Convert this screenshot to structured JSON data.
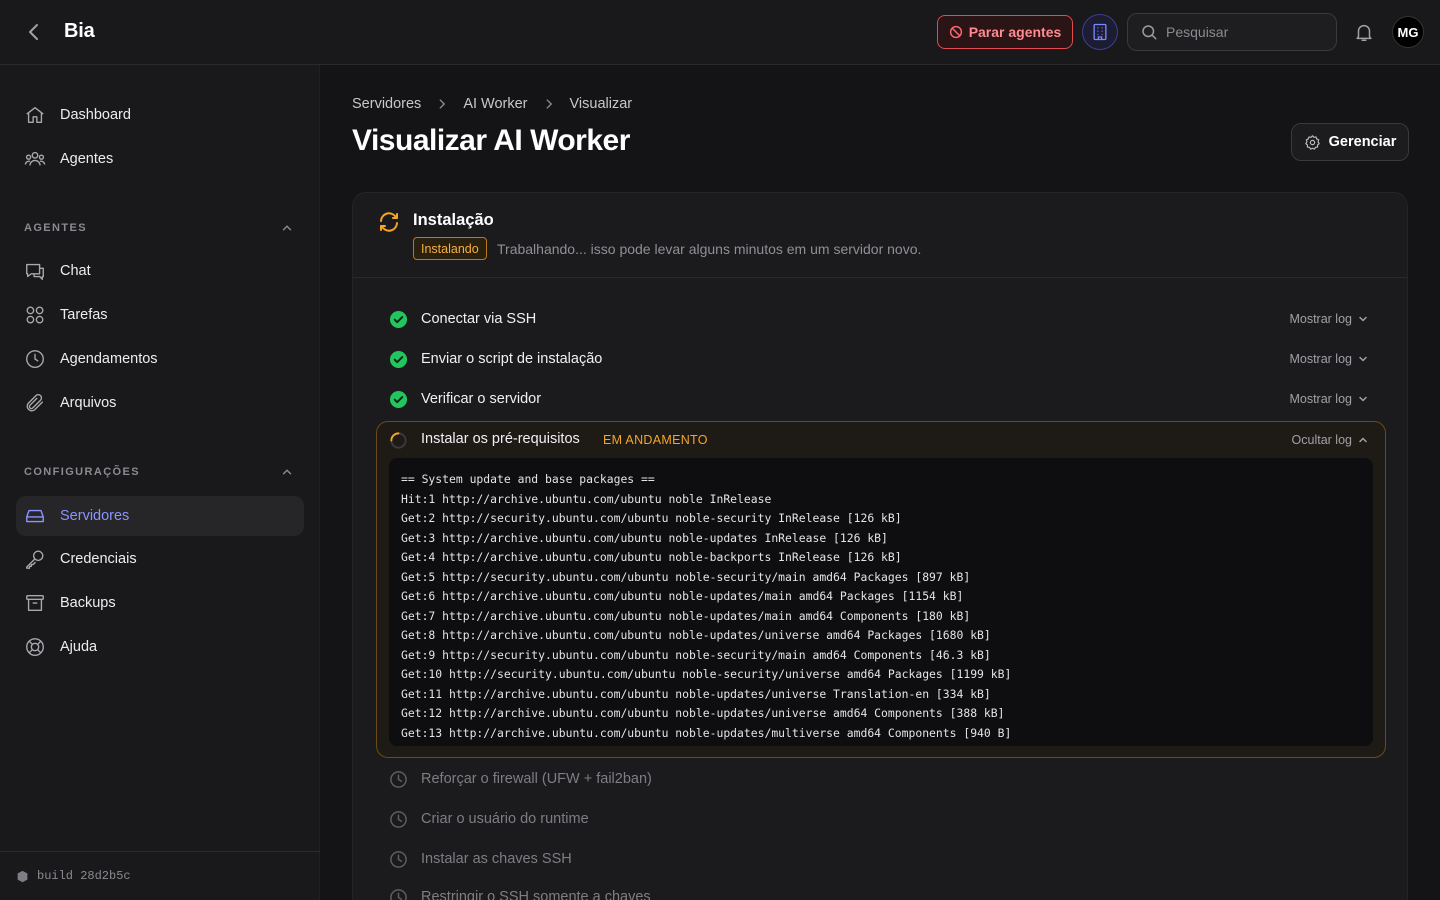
{
  "header": {
    "app_title": "Bia",
    "stop_agents_label": "Parar agentes",
    "search_placeholder": "Pesquisar",
    "avatar_initials": "MG"
  },
  "sidebar": {
    "top_items": [
      {
        "label": "Dashboard",
        "icon": "home-icon"
      },
      {
        "label": "Agentes",
        "icon": "users-icon"
      }
    ],
    "sections": [
      {
        "title": "AGENTES",
        "items": [
          {
            "label": "Chat",
            "icon": "chat-icon"
          },
          {
            "label": "Tarefas",
            "icon": "grid-icon"
          },
          {
            "label": "Agendamentos",
            "icon": "clock-icon"
          },
          {
            "label": "Arquivos",
            "icon": "paperclip-icon"
          }
        ]
      },
      {
        "title": "CONFIGURAÇÕES",
        "items": [
          {
            "label": "Servidores",
            "icon": "server-icon",
            "active": true
          },
          {
            "label": "Credenciais",
            "icon": "key-icon"
          },
          {
            "label": "Backups",
            "icon": "archive-icon"
          },
          {
            "label": "Ajuda",
            "icon": "lifebuoy-icon"
          }
        ]
      }
    ],
    "build_label": "build 28d2b5c"
  },
  "breadcrumb": [
    "Servidores",
    "AI Worker",
    "Visualizar"
  ],
  "page": {
    "title": "Visualizar AI Worker",
    "manage_label": "Gerenciar"
  },
  "installation": {
    "title": "Instalação",
    "badge": "Instalando",
    "subtitle": "Trabalhando... isso pode levar alguns minutos em um servidor novo.",
    "show_log_label": "Mostrar log",
    "hide_log_label": "Ocultar log",
    "done_steps": [
      "Conectar via SSH",
      "Enviar o script de instalação",
      "Verificar o servidor"
    ],
    "active_step": {
      "label": "Instalar os pré-requisitos",
      "status": "EM ANDAMENTO",
      "log": [
        "== System update and base packages ==",
        "Hit:1 http://archive.ubuntu.com/ubuntu noble InRelease",
        "Get:2 http://security.ubuntu.com/ubuntu noble-security InRelease [126 kB]",
        "Get:3 http://archive.ubuntu.com/ubuntu noble-updates InRelease [126 kB]",
        "Get:4 http://archive.ubuntu.com/ubuntu noble-backports InRelease [126 kB]",
        "Get:5 http://security.ubuntu.com/ubuntu noble-security/main amd64 Packages [897 kB]",
        "Get:6 http://archive.ubuntu.com/ubuntu noble-updates/main amd64 Packages [1154 kB]",
        "Get:7 http://archive.ubuntu.com/ubuntu noble-updates/main amd64 Components [180 kB]",
        "Get:8 http://archive.ubuntu.com/ubuntu noble-updates/universe amd64 Packages [1680 kB]",
        "Get:9 http://security.ubuntu.com/ubuntu noble-security/main amd64 Components [46.3 kB]",
        "Get:10 http://security.ubuntu.com/ubuntu noble-security/universe amd64 Packages [1199 kB]",
        "Get:11 http://archive.ubuntu.com/ubuntu noble-updates/universe Translation-en [334 kB]",
        "Get:12 http://archive.ubuntu.com/ubuntu noble-updates/universe amd64 Components [388 kB]",
        "Get:13 http://archive.ubuntu.com/ubuntu noble-updates/multiverse amd64 Components [940 B]"
      ]
    },
    "pending_steps": [
      "Reforçar o firewall (UFW + fail2ban)",
      "Criar o usuário do runtime",
      "Instalar as chaves SSH",
      "Restringir o SSH somente a chaves"
    ]
  },
  "colors": {
    "accent": "#8b94ff",
    "success": "#22c55e",
    "warning": "#f5a524",
    "danger": "#e5484d"
  }
}
